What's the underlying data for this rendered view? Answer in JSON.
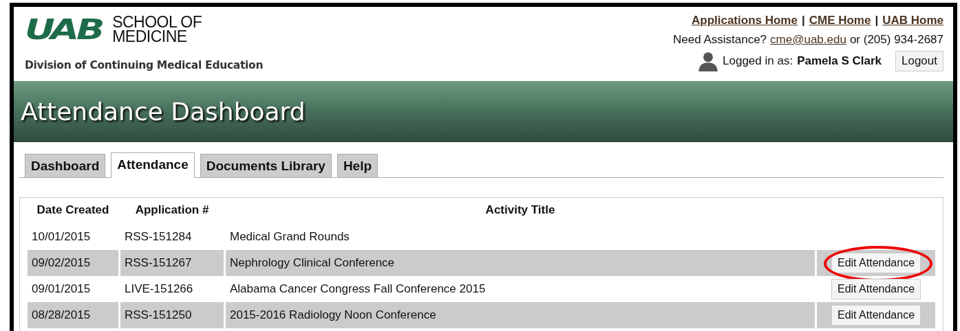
{
  "header": {
    "logo": "UAB",
    "school": [
      "SCHOOL OF",
      "MEDICINE"
    ],
    "division": "Division of Continuing Medical Education",
    "links": [
      "Applications Home",
      "CME Home",
      "UAB Home"
    ],
    "link_separator": "|",
    "assistance": {
      "label": "Need Assistance?",
      "email": "cme@uab.edu",
      "phone": "or (205) 934-2687"
    },
    "user": {
      "label": "Logged in as:",
      "name": "Pamela S Clark"
    },
    "logout": "Logout"
  },
  "banner": {
    "title": "Attendance Dashboard"
  },
  "tabs": [
    {
      "label": "Dashboard",
      "selected": false
    },
    {
      "label": "Attendance",
      "selected": true
    },
    {
      "label": "Documents Library",
      "selected": false
    },
    {
      "label": "Help",
      "selected": false
    }
  ],
  "table": {
    "columns": [
      "Date Created",
      "Application #",
      "Activity Title"
    ],
    "rows": [
      {
        "date": "10/01/2015",
        "application": "RSS-151284",
        "title": "Medical Grand Rounds",
        "striped": false,
        "circled": false
      },
      {
        "date": "09/02/2015",
        "application": "RSS-151267",
        "title": "Nephrology Clinical Conference",
        "button": "Edit Attendance",
        "striped": true,
        "circled": true
      },
      {
        "date": "09/01/2015",
        "application": "LIVE-151266",
        "title": "Alabama Cancer Congress Fall Conference 2015",
        "button": "Edit Attendance",
        "striped": false,
        "circled": false
      },
      {
        "date": "08/28/2015",
        "application": "RSS-151250",
        "title": "2015-2016 Radiology Noon Conference",
        "button": "Edit Attendance",
        "striped": true,
        "circled": false
      }
    ]
  }
}
